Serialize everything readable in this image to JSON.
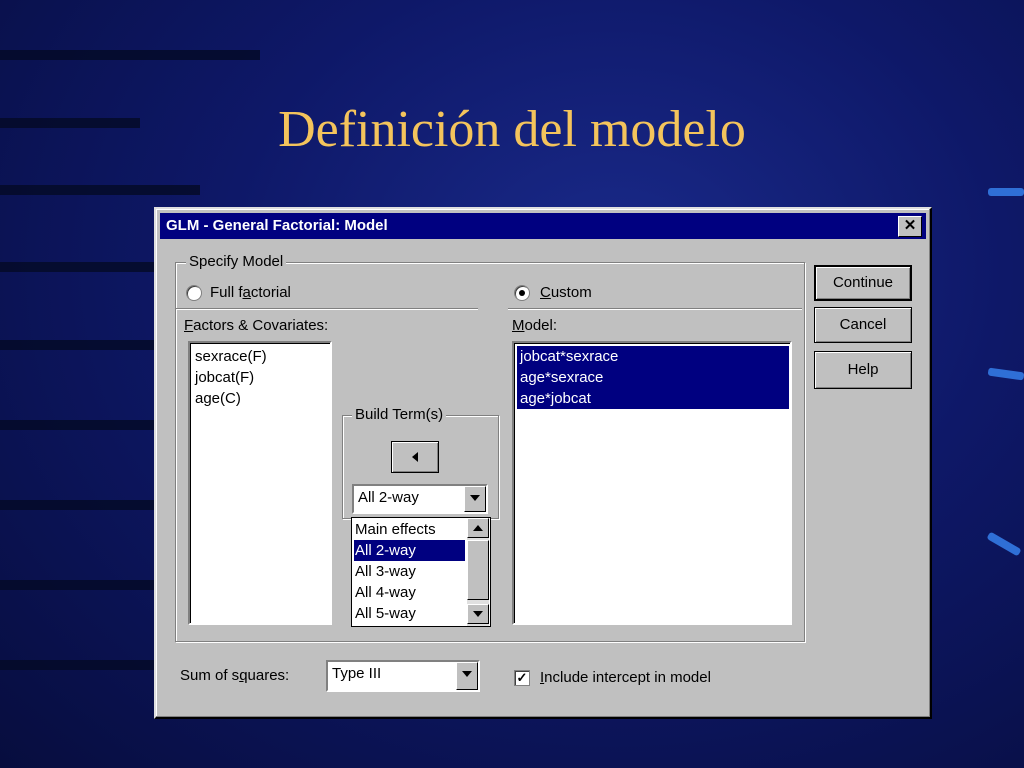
{
  "slide": {
    "title": "Definición del modelo"
  },
  "dialog": {
    "title": "GLM - General Factorial: Model",
    "close_label": "✕",
    "specify_model": {
      "label": "Specify Model",
      "full_factorial": {
        "pre": "Full f",
        "u": "a",
        "post": "ctorial",
        "selected": false
      },
      "custom": {
        "pre": "",
        "u": "C",
        "post": "ustom",
        "selected": true
      }
    },
    "factors": {
      "label_u": "F",
      "label_rest": "actors & Covariates:",
      "items": [
        "sexrace(F)",
        "jobcat(F)",
        "age(C)"
      ]
    },
    "build_terms": {
      "label": "Build Term(s)",
      "arrow_button": "◄",
      "selected": "All 2-way",
      "options": [
        "Main effects",
        "All 2-way",
        "All 3-way",
        "All 4-way",
        "All 5-way"
      ],
      "highlighted_option": "All 2-way"
    },
    "model": {
      "label_u": "M",
      "label_rest": "odel:",
      "items": [
        "jobcat*sexrace",
        "age*sexrace",
        "age*jobcat"
      ]
    },
    "buttons": {
      "continue": "Continue",
      "cancel": "Cancel",
      "help": "Help"
    },
    "sum_of_squares": {
      "label_pre": "Sum of s",
      "label_u": "q",
      "label_post": "uares:",
      "value": "Type III"
    },
    "include_intercept": {
      "checked": true,
      "check_mark": "✓",
      "label_u": "I",
      "label_rest": "nclude intercept in model"
    }
  }
}
